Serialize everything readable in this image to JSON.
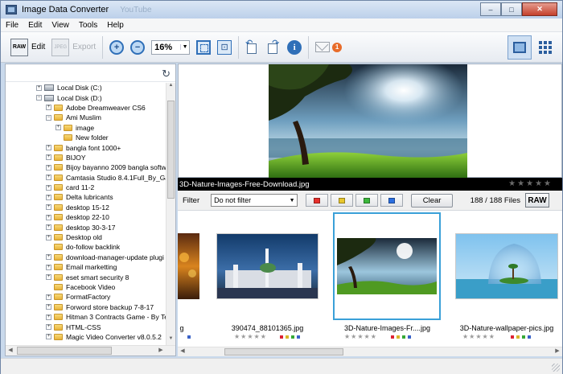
{
  "window": {
    "title": "Image Data Converter",
    "ghost_title": "YouTube",
    "btn_min": "‒",
    "btn_max": "□",
    "btn_close": "✕"
  },
  "menu": [
    "File",
    "Edit",
    "View",
    "Tools",
    "Help"
  ],
  "toolbar": {
    "raw_icon_text": "RAW",
    "edit_label": "Edit",
    "jpeg_icon_text": "JPEG",
    "export_label": "Export",
    "zoom_in_icon": "+",
    "zoom_out_icon": "−",
    "zoom_value": "16%",
    "zoom_dropdown": "▼",
    "actual_size_icon": "⊡",
    "info_icon": "i",
    "notification_count": "1"
  },
  "tree": {
    "refresh_icon": "↻",
    "nodes": [
      {
        "label": "Local Disk (C:)",
        "exp": "+",
        "icon": "disk",
        "indent": 0
      },
      {
        "label": "Local Disk (D:)",
        "exp": "−",
        "icon": "disk",
        "indent": 0
      },
      {
        "label": "Adobe Dreamweaver CS6",
        "exp": "+",
        "icon": "folder",
        "indent": 1
      },
      {
        "label": "Ami Muslim",
        "exp": "−",
        "icon": "folder",
        "indent": 1
      },
      {
        "label": "image",
        "exp": "+",
        "icon": "folder",
        "indent": 2
      },
      {
        "label": "New folder",
        "exp": "",
        "icon": "folder",
        "indent": 2
      },
      {
        "label": "bangla font 1000+",
        "exp": "+",
        "icon": "folder",
        "indent": 1
      },
      {
        "label": "BIJOY",
        "exp": "+",
        "icon": "folder",
        "indent": 1
      },
      {
        "label": "Bijoy bayanno 2009 bangla softw",
        "exp": "+",
        "icon": "folder",
        "indent": 1
      },
      {
        "label": "Camtasia Studio 8.4.1Full_By_Ga",
        "exp": "+",
        "icon": "folder",
        "indent": 1
      },
      {
        "label": "card 11-2",
        "exp": "+",
        "icon": "folder",
        "indent": 1
      },
      {
        "label": "Delta lubricants",
        "exp": "+",
        "icon": "folder",
        "indent": 1
      },
      {
        "label": "desktop 15-12",
        "exp": "+",
        "icon": "folder",
        "indent": 1
      },
      {
        "label": "desktop 22-10",
        "exp": "+",
        "icon": "folder",
        "indent": 1
      },
      {
        "label": "desktop 30-3-17",
        "exp": "+",
        "icon": "folder",
        "indent": 1
      },
      {
        "label": "Desktop old",
        "exp": "+",
        "icon": "folder",
        "indent": 1
      },
      {
        "label": "do-follow backlink",
        "exp": "",
        "icon": "folder",
        "indent": 1
      },
      {
        "label": "download-manager-update plugi",
        "exp": "+",
        "icon": "folder",
        "indent": 1
      },
      {
        "label": "Email marketting",
        "exp": "+",
        "icon": "folder",
        "indent": 1
      },
      {
        "label": "eset smart security 8",
        "exp": "+",
        "icon": "folder",
        "indent": 1
      },
      {
        "label": "Facebook Video",
        "exp": "",
        "icon": "folder",
        "indent": 1
      },
      {
        "label": "FormatFactory",
        "exp": "+",
        "icon": "folder",
        "indent": 1
      },
      {
        "label": "Forword store backup 7-8-17",
        "exp": "+",
        "icon": "folder",
        "indent": 1
      },
      {
        "label": "Hitman 3 Contracts Game - By Te",
        "exp": "+",
        "icon": "folder",
        "indent": 1
      },
      {
        "label": "HTML-CSS",
        "exp": "+",
        "icon": "folder",
        "indent": 1
      },
      {
        "label": "Magic Video Converter v8.0.5.2",
        "exp": "+",
        "icon": "folder",
        "indent": 1
      }
    ]
  },
  "preview": {
    "filename": "3D-Nature-Images-Free-Download.jpg",
    "stars": "★★★★★"
  },
  "filter": {
    "label": "Filter",
    "select_value": "Do not filter",
    "select_arrow": "▼",
    "colors": [
      "#e8302c",
      "#e8c62c",
      "#3cb83c",
      "#2c6fe0"
    ],
    "clear_label": "Clear",
    "count": "188 / 188 Files",
    "raw_label": "RAW"
  },
  "thumbnails": [
    {
      "caption": "g",
      "stars": "",
      "selected": false
    },
    {
      "caption": "390474_88101365.jpg",
      "stars": "★★★★★",
      "selected": false
    },
    {
      "caption": "3D-Nature-Images-Fr....jpg",
      "stars": "★★★★★",
      "selected": true
    },
    {
      "caption": "3D-Nature-wallpaper-pics.jpg",
      "stars": "★★★★★",
      "selected": false
    }
  ],
  "scroll_arrows": {
    "up": "▲",
    "down": "▼",
    "left": "◀",
    "right": "▶"
  }
}
